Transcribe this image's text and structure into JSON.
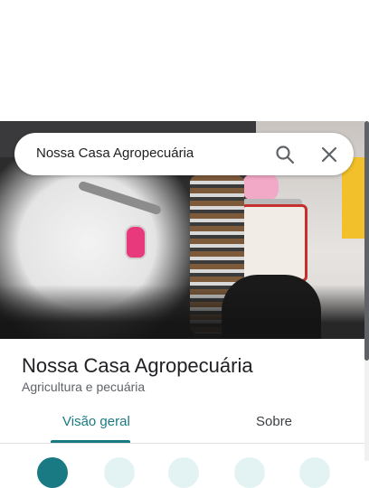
{
  "search": {
    "value": "Nossa Casa Agropecuária"
  },
  "place": {
    "name": "Nossa Casa Agropecuária",
    "category": "Agricultura e pecuária"
  },
  "tabs": [
    {
      "label": "Visão geral",
      "selected": true
    },
    {
      "label": "Sobre",
      "selected": false
    }
  ],
  "icons": {
    "search": "search-icon",
    "close": "close-icon"
  },
  "colors": {
    "accent": "#1a7a84",
    "text": "#202124",
    "secondary_text": "#5f6368"
  }
}
